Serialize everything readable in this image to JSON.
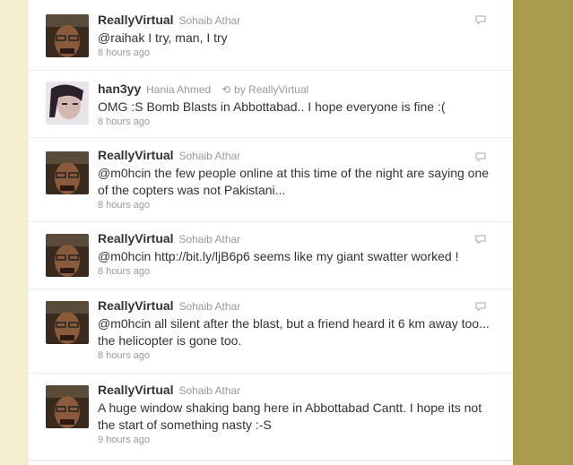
{
  "colors": {
    "page_bg": "#f4efcf",
    "side_bg": "#a99b4c",
    "timeline_bg": "#ffffff",
    "text": "#333333",
    "muted": "#999999"
  },
  "icons": {
    "retweet": "retweet-icon",
    "reply": "reply-icon"
  },
  "tweets": [
    {
      "screen_name": "ReallyVirtual",
      "full_name": "Sohaib Athar",
      "text": "@raihak I try, man, I try",
      "time": "8 hours ago"
    },
    {
      "screen_name": "han3yy",
      "full_name": "Hania Ahmed",
      "retweet_icon": "⟲",
      "retweeted_by": "by ReallyVirtual",
      "text": "OMG :S Bomb Blasts in Abbottabad.. I hope everyone is fine :(",
      "time": "8 hours ago"
    },
    {
      "screen_name": "ReallyVirtual",
      "full_name": "Sohaib Athar",
      "text": "@m0hcin the few people online at this time of the night are saying one of the copters was not Pakistani...",
      "time": "8 hours ago"
    },
    {
      "screen_name": "ReallyVirtual",
      "full_name": "Sohaib Athar",
      "text": "@m0hcin http://bit.ly/ljB6p6 seems like my giant swatter worked !",
      "time": "8 hours ago"
    },
    {
      "screen_name": "ReallyVirtual",
      "full_name": "Sohaib Athar",
      "text": "@m0hcin all silent after the blast, but a friend heard it 6 km away too... the helicopter is gone too.",
      "time": "8 hours ago"
    },
    {
      "screen_name": "ReallyVirtual",
      "full_name": "Sohaib Athar",
      "text": "A huge window shaking bang here in Abbottabad Cantt. I hope its not the start of something nasty :-S",
      "time": "9 hours ago"
    }
  ]
}
